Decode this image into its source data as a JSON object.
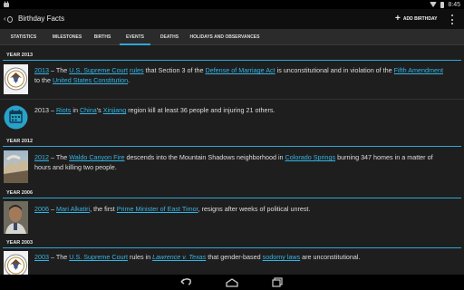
{
  "status_bar": {
    "time": "8:45"
  },
  "app": {
    "title": "Birthday Facts",
    "add_label": "ADD BIRTHDAY"
  },
  "colors": {
    "accent": "#2fa7d6",
    "link": "#33b5e5"
  },
  "tabs": [
    {
      "label": "STATISTICS"
    },
    {
      "label": "MILESTONES"
    },
    {
      "label": "BIRTHS"
    },
    {
      "label": "EVENTS",
      "active": true
    },
    {
      "label": "DEATHS"
    },
    {
      "label": "HOLIDAYS AND OBSERVANCES"
    }
  ],
  "years": [
    "YEAR 2013",
    "YEAR 2012",
    "YEAR 2006",
    "YEAR 2003"
  ],
  "entries": [
    {
      "icon": "us-supreme-court-seal-icon",
      "parts": [
        {
          "t": "2013",
          "link": true
        },
        {
          "t": " – The "
        },
        {
          "t": "U.S. Supreme Court",
          "link": true
        },
        {
          "t": " "
        },
        {
          "t": "rules",
          "link": true
        },
        {
          "t": " that Section 3 of the "
        },
        {
          "t": "Defense of Marriage Act",
          "link": true
        },
        {
          "t": " is unconstitutional and in violation of the "
        },
        {
          "t": "Fifth Amendment",
          "link": true
        },
        {
          "t": " to the "
        },
        {
          "t": "United States Constitution",
          "link": true
        },
        {
          "t": "."
        }
      ]
    },
    {
      "icon": "calendar-icon",
      "parts": [
        {
          "t": "2013 – "
        },
        {
          "t": "Riots",
          "link": true
        },
        {
          "t": " in "
        },
        {
          "t": "China",
          "link": true
        },
        {
          "t": "'s "
        },
        {
          "t": "Xinjiang",
          "link": true
        },
        {
          "t": " region kill at least 36 people and injuring 21 others."
        }
      ]
    },
    {
      "icon": "wildfire-photo-icon",
      "parts": [
        {
          "t": "2012",
          "link": true
        },
        {
          "t": " – The "
        },
        {
          "t": "Waldo Canyon Fire",
          "link": true
        },
        {
          "t": " descends into the Mountain Shadows neighborhood in "
        },
        {
          "t": "Colorado Springs",
          "link": true
        },
        {
          "t": " burning 347 homes in a matter of hours and killing two people."
        }
      ]
    },
    {
      "icon": "portrait-photo-icon",
      "parts": [
        {
          "t": "2006",
          "link": true
        },
        {
          "t": " – "
        },
        {
          "t": "Mari Alkatiri",
          "link": true
        },
        {
          "t": ", the first "
        },
        {
          "t": "Prime Minister of East Timor",
          "link": true
        },
        {
          "t": ", resigns after weeks of political unrest."
        }
      ]
    },
    {
      "icon": "us-supreme-court-seal-icon",
      "parts": [
        {
          "t": "2003",
          "link": true
        },
        {
          "t": " – The "
        },
        {
          "t": "U.S. Supreme Court",
          "link": true
        },
        {
          "t": " rules in "
        },
        {
          "t": "Lawrence v. Texas",
          "link": true,
          "italic": true
        },
        {
          "t": " that gender-based "
        },
        {
          "t": "sodomy laws",
          "link": true
        },
        {
          "t": " are unconstitutional."
        }
      ]
    }
  ],
  "nav": {
    "back": "back-icon",
    "home": "home-icon",
    "recents": "recents-icon"
  }
}
